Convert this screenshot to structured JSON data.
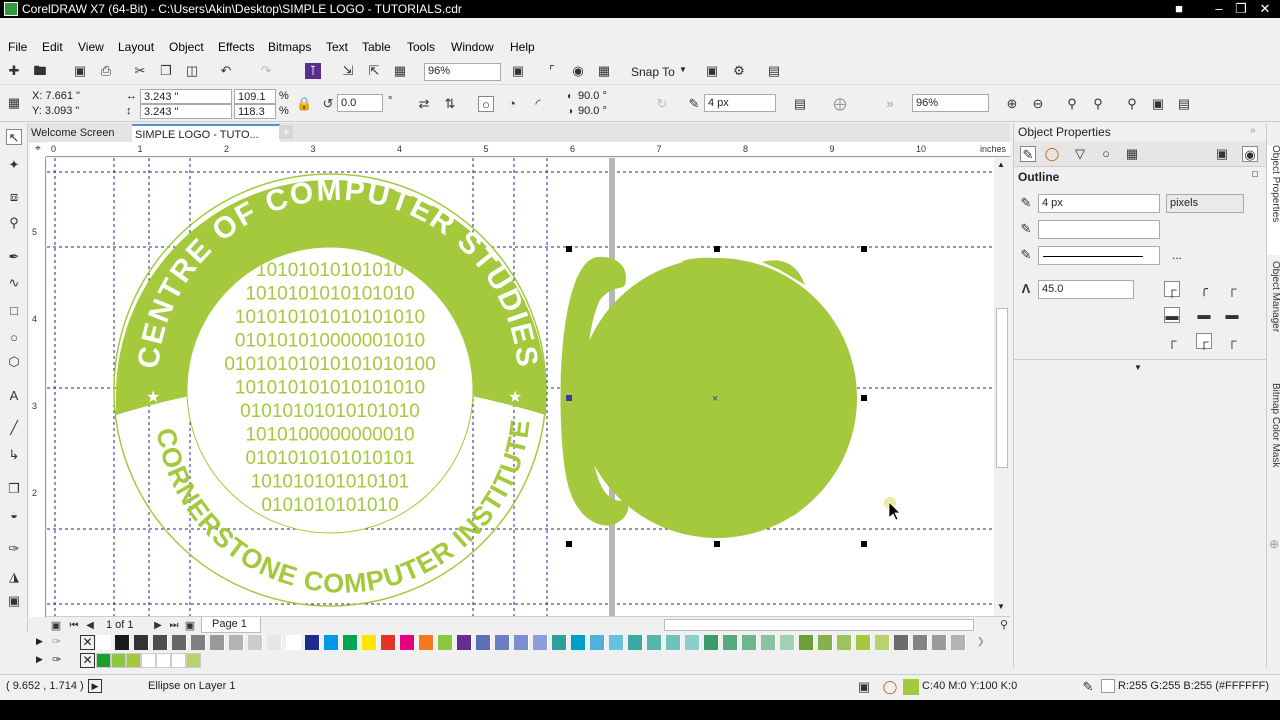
{
  "window": {
    "title": "CorelDRAW X7 (64-Bit) - C:\\Users\\Akin\\Desktop\\SIMPLE LOGO - TUTORIALS.cdr"
  },
  "menu": [
    "File",
    "Edit",
    "View",
    "Layout",
    "Object",
    "Effects",
    "Bitmaps",
    "Text",
    "Table",
    "Tools",
    "Window",
    "Help"
  ],
  "toolbar": {
    "zoom": "96%",
    "snap_to": "Snap To"
  },
  "propertybar": {
    "x": "X: 7.661 \"",
    "y": "Y: 3.093 \"",
    "w": "3.243 \"",
    "h": "3.243 \"",
    "scale_x": "109.1",
    "scale_y": "118.3",
    "pct": "%",
    "rotation": "0.0",
    "deg": "°",
    "start_angle": "90.0 °",
    "end_angle": "90.0 °",
    "outline_width": "4 px",
    "zoom2": "96%"
  },
  "tabs": [
    "Welcome Screen",
    "SIMPLE LOGO - TUTO..."
  ],
  "ruler": {
    "units": "inches",
    "h_labels": [
      "0",
      "1",
      "2",
      "3",
      "4",
      "5",
      "6",
      "7",
      "8",
      "9",
      "10"
    ],
    "v_labels": [
      "5",
      "4",
      "3",
      "2"
    ]
  },
  "logo": {
    "top_text": "CENTRE OF COMPUTER STUDIES",
    "bottom_text": "CORNERSTONE COMPUTER INSTITUTE",
    "binary_rows": [
      "10101010101010",
      "1010101010101010",
      "101010101010101010",
      "010101010000001010",
      "01010101010101010100",
      "101010101010101010",
      "01010101010101010",
      "1010100000000010",
      "0101010101010101",
      "101010101010101",
      "0101010101010"
    ],
    "fill_color": "#a4c93c"
  },
  "pages": {
    "counter": "1 of 1",
    "page_tab": "Page 1"
  },
  "docker": {
    "title": "Object Properties",
    "section": "Outline",
    "width_value": "4 px",
    "units": "pixels",
    "miter": "45.0",
    "more": "...",
    "side_tabs": [
      "Object Properties",
      "Object Manager",
      "Bitmap Color Mask"
    ]
  },
  "status": {
    "coords": "( 9.652 , 1.714 )",
    "object_info": "Ellipse on Layer 1",
    "fill_info": "C:40 M:0 Y:100 K:0",
    "outline_info": "R:255 G:255 B:255 (#FFFFFF)"
  },
  "palette_colors": [
    "#ffffff",
    "#1a1a1a",
    "#333333",
    "#4d4d4d",
    "#666666",
    "#808080",
    "#999999",
    "#b3b3b3",
    "#cccccc",
    "#e6e6e6",
    "#ffffff",
    "#1f2b8f",
    "#0099e6",
    "#00a651",
    "#ffe500",
    "#e6332a",
    "#e4007f",
    "#f47920",
    "#8dc63f",
    "#662d91",
    "#5a6fb5",
    "#6d7fc2",
    "#7b8fcf",
    "#8a9fda",
    "#2f9e9e",
    "#00a0c6",
    "#4fb3d9",
    "#66c2e0",
    "#3aa99f",
    "#55b6ad",
    "#6fc3bb",
    "#8ad0c9",
    "#3e9c6a",
    "#56a97d",
    "#6fb68f",
    "#88c3a2",
    "#a1d0b5",
    "#6e9e3a",
    "#86b04d",
    "#9fc260",
    "#a4c93c",
    "#b8d36a",
    "#6b6b6b",
    "#838383",
    "#9b9b9b",
    "#b3b3b3"
  ],
  "recent_colors": [
    "#1a9f2e",
    "#8dc63f",
    "#a4c93c",
    "#ffffff",
    "#ffffff",
    "#ffffff",
    "#b8d36a"
  ]
}
